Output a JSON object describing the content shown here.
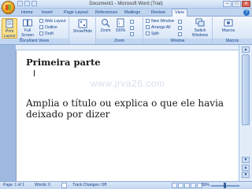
{
  "window": {
    "title": "Document1 - Microsoft Word (Trial)",
    "controls": [
      "–",
      "□",
      "✕"
    ]
  },
  "tabs": [
    "Home",
    "Insert",
    "Page Layout",
    "References",
    "Mailings",
    "Review",
    "View"
  ],
  "active_tab": "View",
  "ribbon": {
    "document_views": {
      "label": "Document Views",
      "print_layout": "Print Layout",
      "full_screen_reading": "Full Screen Reading",
      "web_layout": "Web Layout",
      "outline": "Outline",
      "draft": "Draft"
    },
    "show_hide": {
      "label": "Show/Hide"
    },
    "zoom": {
      "label": "Zoom",
      "zoom_btn": "Zoom",
      "percent_btn": "100%"
    },
    "window": {
      "label": "Window",
      "new_window": "New Window",
      "arrange_all": "Arrange All",
      "split": "Split",
      "switch_windows": "Switch Windows"
    },
    "macros": {
      "label": "Macros",
      "macros_btn": "Macros"
    }
  },
  "document": {
    "heading": "Primeira parte",
    "paragraph": "Amplia o título ou explica o que ele havia deixado por dizer",
    "watermark": "www.jrva26.com"
  },
  "statusbar": {
    "page": "Page: 1 of 1",
    "words": "Words: 0",
    "track_changes": "Track Changes: Off",
    "zoom": "80%"
  },
  "colors": {
    "ribbon": "#dde9f8",
    "accent": "#15428b",
    "doc_background": "#9db9df"
  }
}
